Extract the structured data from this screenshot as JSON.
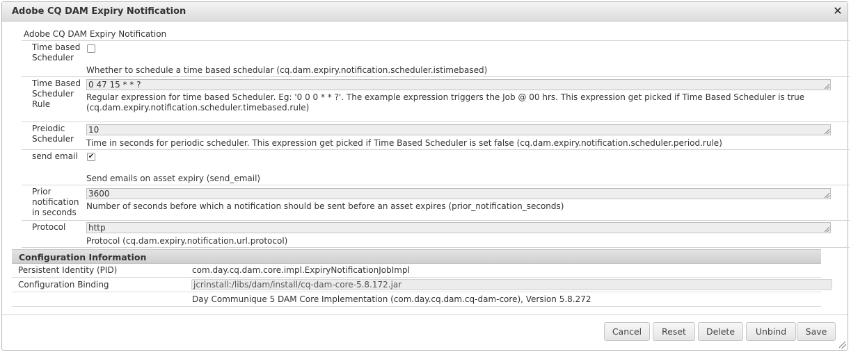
{
  "dialog": {
    "title": "Adobe CQ DAM Expiry Notification",
    "close_icon": "close-icon"
  },
  "section_heading": "Adobe CQ DAM Expiry Notification",
  "fields": [
    {
      "label": "Time based Scheduler",
      "type": "checkbox",
      "checked": false,
      "description": "Whether to schedule a time based schedular (cq.dam.expiry.notification.scheduler.istimebased)"
    },
    {
      "label": "Time Based Scheduler Rule",
      "type": "text",
      "value": "0 47 15 * * ?",
      "description": "Regular expression for time based Scheduler. Eg: '0 0 0 * * ?'. The example expression triggers the Job @ 00 hrs. This expression get picked if Time Based Scheduler is true (cq.dam.expiry.notification.scheduler.timebased.rule)"
    },
    {
      "label": "Preiodic Scheduler",
      "type": "text",
      "value": "10",
      "description": "Time in seconds for periodic scheduler. This expression get picked if Time Based Scheduler is set false (cq.dam.expiry.notification.scheduler.period.rule)"
    },
    {
      "label": "send email",
      "type": "checkbox",
      "checked": true,
      "description": "Send emails on asset expiry (send_email)"
    },
    {
      "label": "Prior notification in seconds",
      "type": "text",
      "value": "3600",
      "description": "Number of seconds before which a notification should be sent before an asset expires (prior_notification_seconds)"
    },
    {
      "label": "Protocol",
      "type": "text",
      "value": "http",
      "description": "Protocol (cq.dam.expiry.notification.url.protocol)"
    }
  ],
  "config_info": {
    "heading": "Configuration Information",
    "rows": [
      {
        "key": "Persistent Identity (PID)",
        "value": "com.day.cq.dam.core.impl.ExpiryNotificationJobImpl"
      },
      {
        "key": "Configuration Binding",
        "value": "jcrinstall:/libs/dam/install/cq-dam-core-5.8.172.jar"
      },
      {
        "key": "",
        "value": "Day Communique 5 DAM Core Implementation (com.day.cq.dam.cq-dam-core), Version 5.8.272"
      }
    ]
  },
  "buttons": {
    "cancel": "Cancel",
    "reset": "Reset",
    "delete": "Delete",
    "unbind": "Unbind",
    "save": "Save"
  }
}
